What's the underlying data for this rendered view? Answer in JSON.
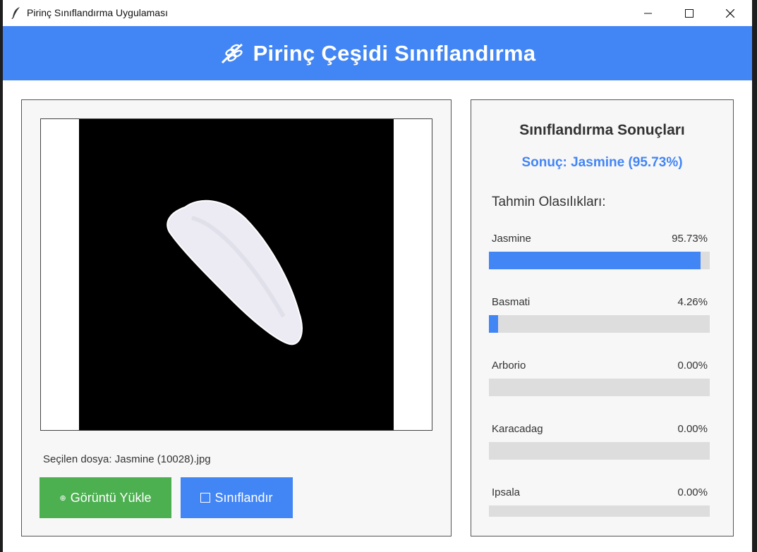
{
  "window": {
    "title": "Pirinç Sınıflandırma Uygulaması"
  },
  "header": {
    "title": "Pirinç Çeşidi Sınıflandırma"
  },
  "left": {
    "file_label": "Seçilen dosya: Jasmine (10028).jpg",
    "load_button": "Görüntü Yükle",
    "classify_button": "Sınıflandır"
  },
  "results": {
    "title": "Sınıflandırma Sonuçları",
    "result_text": "Sonuç: Jasmine (95.73%)",
    "subtitle": "Tahmin Olasılıkları:",
    "items": [
      {
        "name": "Jasmine",
        "value_text": "95.73%",
        "value": 95.73
      },
      {
        "name": "Basmati",
        "value_text": "4.26%",
        "value": 4.26
      },
      {
        "name": "Arborio",
        "value_text": "0.00%",
        "value": 0.0
      },
      {
        "name": "Karacadag",
        "value_text": "0.00%",
        "value": 0.0
      },
      {
        "name": "Ipsala",
        "value_text": "0.00%",
        "value": 0.0
      }
    ]
  },
  "colors": {
    "accent": "#4285f4",
    "load_button": "#4caf50",
    "track": "#dddddd"
  },
  "icons": {
    "title_icon": "feather-icon",
    "header_icon": "rice-stalk-icon"
  }
}
